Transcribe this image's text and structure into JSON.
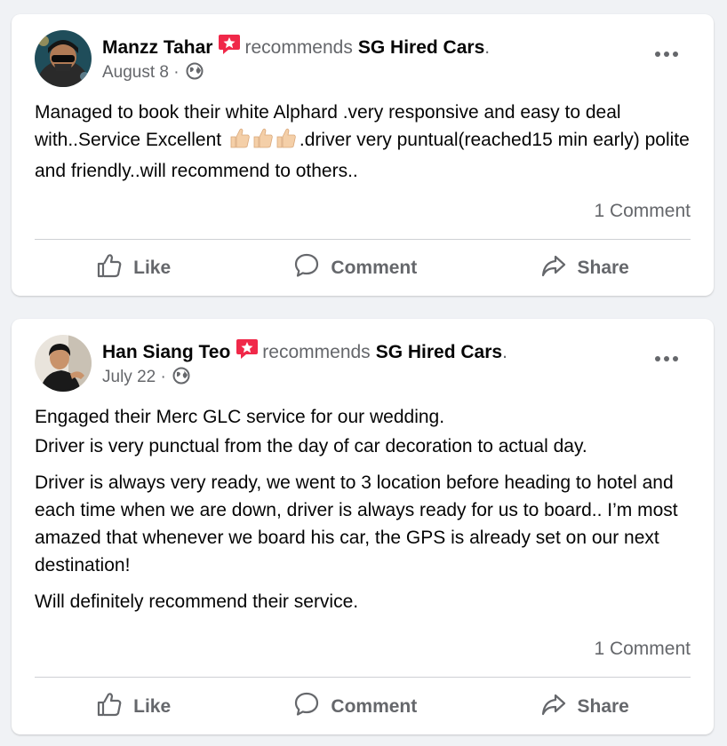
{
  "posts": [
    {
      "author": "Manzz Tahar",
      "verb": "recommends",
      "page": "SG Hired Cars",
      "date": "August 8 ·",
      "paragraphs": [
        "Managed to book their white Alphard .very responsive  and easy to deal with..Service Excellent ",
        ".driver very puntual(reached15 min early) polite and friendly..will recommend to others.."
      ],
      "comments": "1 Comment",
      "actions": {
        "like": "Like",
        "comment": "Comment",
        "share": "Share"
      }
    },
    {
      "author": "Han Siang Teo",
      "verb": "recommends",
      "page": "SG Hired Cars",
      "date": "July 22 ·",
      "paragraphs": [
        "Engaged their Merc GLC service for our wedding.",
        "Driver is very punctual from the day of car decoration to actual day.",
        "Driver is always very ready, we went to 3 location before heading to hotel and each time when we are down, driver is always ready for us to board.. I’m most amazed that whenever we board his car, the GPS is already set on our next destination!",
        "Will definitely recommend their service."
      ],
      "comments": "1 Comment",
      "actions": {
        "like": "Like",
        "comment": "Comment",
        "share": "Share"
      }
    }
  ],
  "icons": {
    "recommend": "recommend-star-icon",
    "privacy": "globe-icon",
    "like": "thumbs-up-icon",
    "comment": "comment-bubble-icon",
    "share": "share-arrow-icon",
    "more": "more-options-icon"
  },
  "colors": {
    "recommend_badge": "#f02849",
    "secondary_text": "#65676b",
    "primary_text": "#050505",
    "background": "#f0f2f5",
    "card": "#ffffff"
  }
}
